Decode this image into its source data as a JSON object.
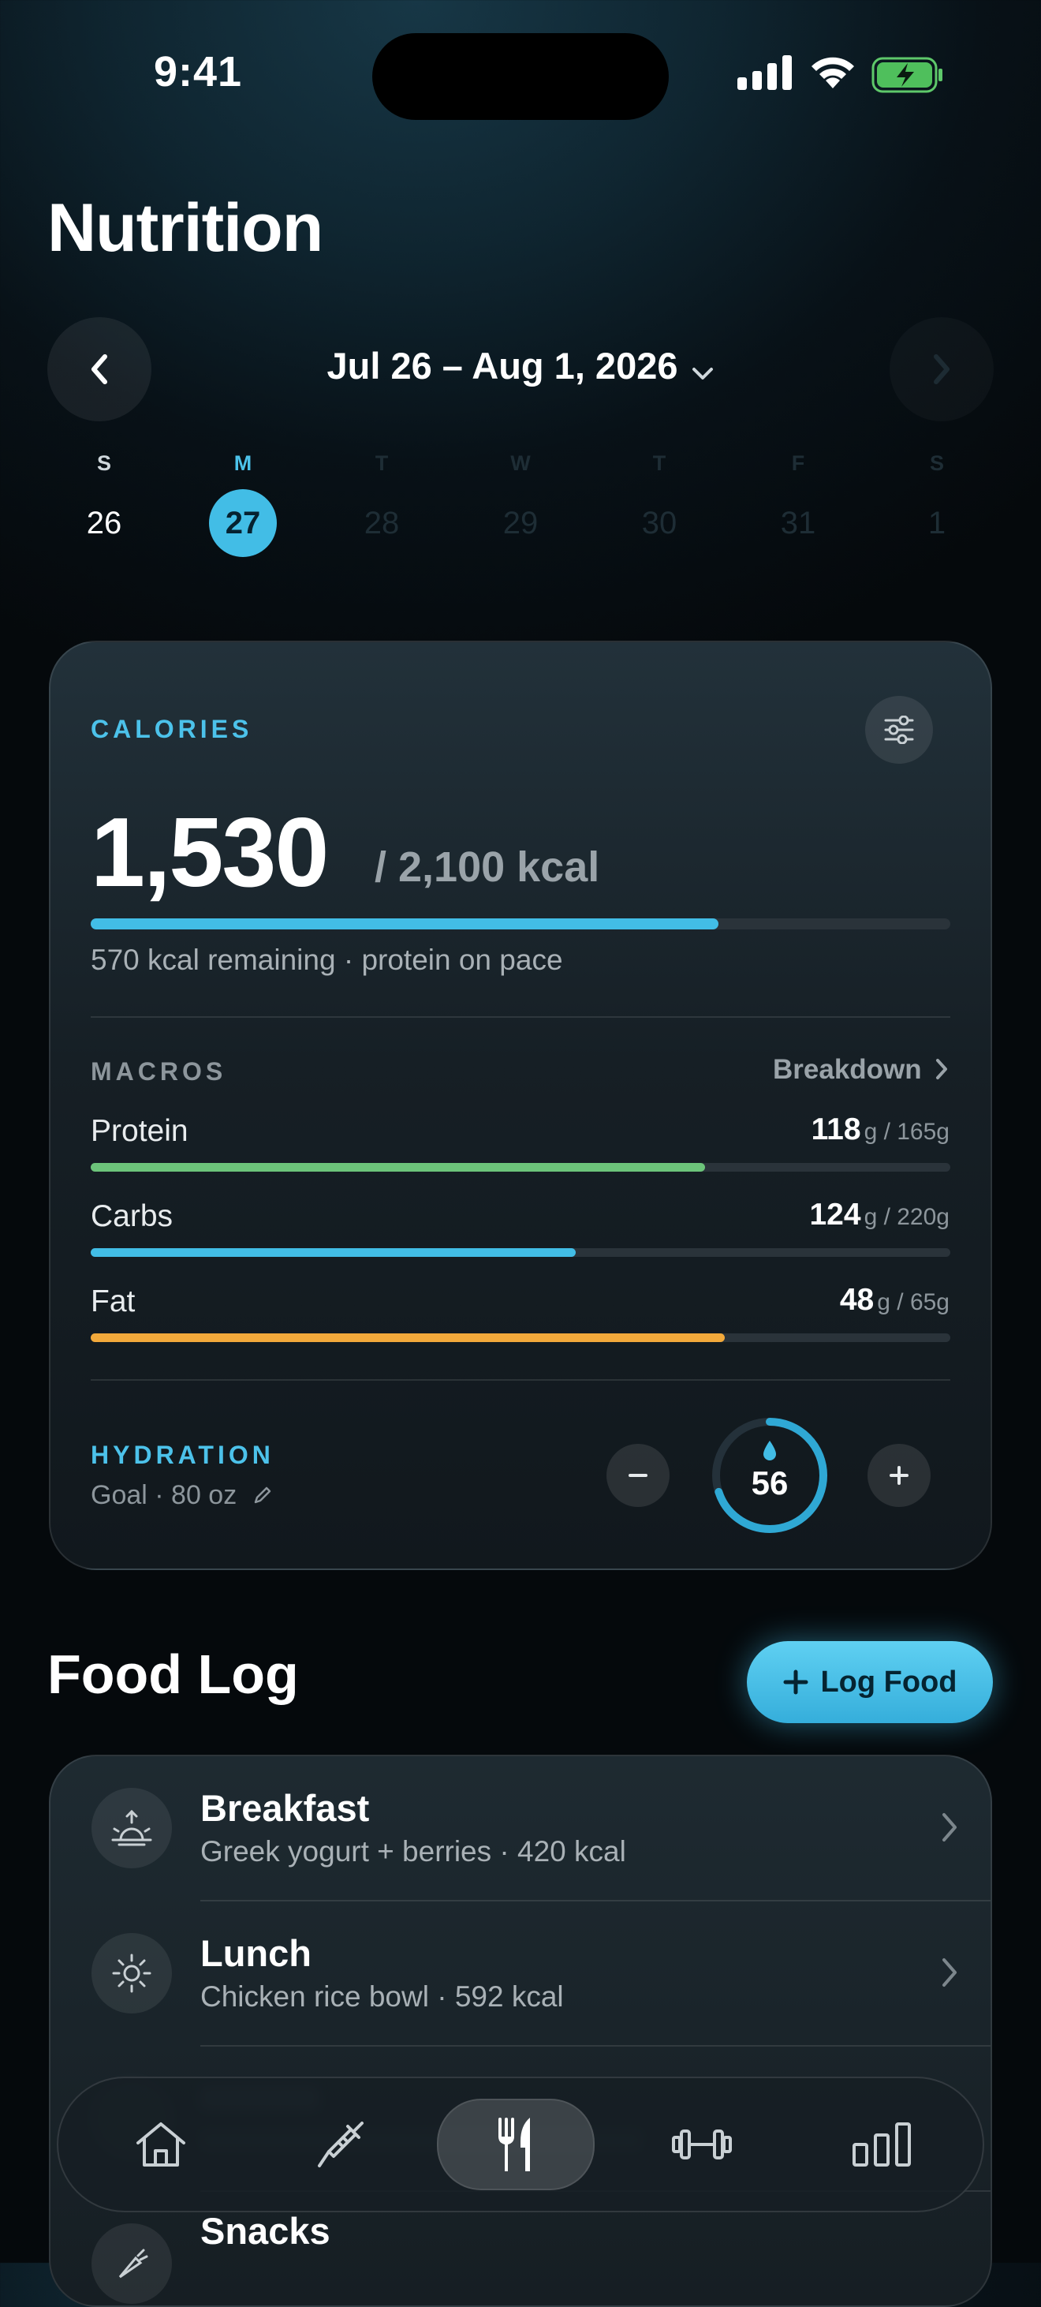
{
  "status_bar": {
    "time": "9:41"
  },
  "header": {
    "title": "Nutrition",
    "date_range": "Jul 26 – Aug 1, 2026"
  },
  "week": [
    {
      "dow": "S",
      "day": "26",
      "state": "past"
    },
    {
      "dow": "M",
      "day": "27",
      "state": "selected"
    },
    {
      "dow": "T",
      "day": "28",
      "state": "future"
    },
    {
      "dow": "W",
      "day": "29",
      "state": "future"
    },
    {
      "dow": "T",
      "day": "30",
      "state": "future"
    },
    {
      "dow": "F",
      "day": "31",
      "state": "future"
    },
    {
      "dow": "S",
      "day": "1",
      "state": "future"
    }
  ],
  "calories": {
    "label": "CALORIES",
    "consumed": "1,530",
    "goal": "/ 2,100 kcal",
    "progress": 0.73,
    "subtitle": "570 kcal remaining · protein on pace"
  },
  "macros": {
    "label": "MACROS",
    "breakdown_link": "Breakdown",
    "items": [
      {
        "name": "Protein",
        "value": "118",
        "suffix": "g / 165g",
        "progress": 0.715,
        "color": "#6cc47a"
      },
      {
        "name": "Carbs",
        "value": "124",
        "suffix": "g / 220g",
        "progress": 0.564,
        "color": "#42bde6"
      },
      {
        "name": "Fat",
        "value": "48",
        "suffix": "g / 65g",
        "progress": 0.738,
        "color": "#f2a93b"
      }
    ]
  },
  "hydration": {
    "label": "HYDRATION",
    "goal": "Goal · 80 oz",
    "value": "56",
    "progress": 0.7
  },
  "food_log": {
    "title": "Food Log",
    "log_button": "Log Food",
    "meals": [
      {
        "name": "Breakfast",
        "detail": "Greek yogurt + berries · 420 kcal",
        "icon": "sunrise-icon"
      },
      {
        "name": "Lunch",
        "detail": "Chicken rice bowl · 592 kcal",
        "icon": "sun-icon"
      },
      {
        "name": "Snacks",
        "detail": "",
        "icon": "carrot-icon"
      }
    ]
  },
  "tabs": [
    {
      "name": "home",
      "icon": "home-icon"
    },
    {
      "name": "injections",
      "icon": "syringe-icon"
    },
    {
      "name": "nutrition",
      "icon": "fork-knife-icon",
      "active": true
    },
    {
      "name": "workouts",
      "icon": "dumbbell-icon"
    },
    {
      "name": "stats",
      "icon": "bar-chart-icon"
    }
  ],
  "colors": {
    "accent": "#42bde6",
    "protein": "#6cc47a",
    "carbs": "#42bde6",
    "fat": "#f2a93b"
  }
}
